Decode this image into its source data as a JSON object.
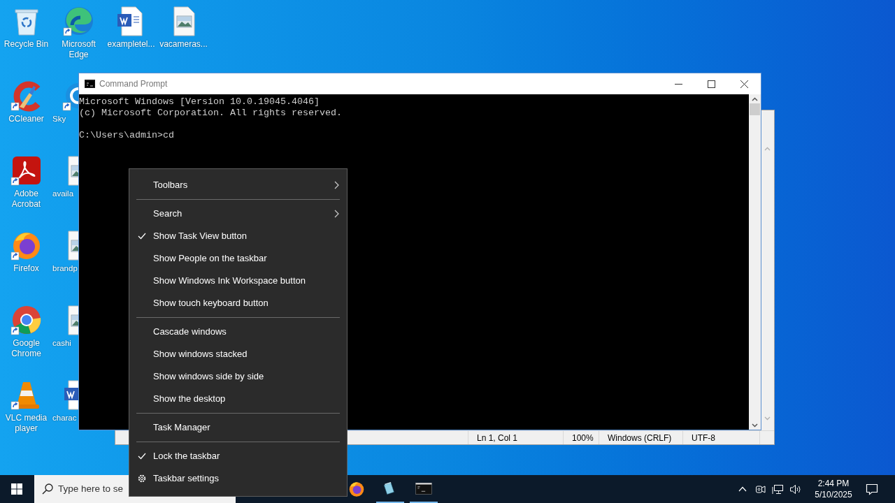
{
  "desktop": {
    "columns": [
      [
        {
          "label": "Recycle Bin",
          "kind": "recycle",
          "shortcut": false,
          "partly_hidden": false
        },
        {
          "label": "CCleaner",
          "kind": "ccleaner",
          "shortcut": true,
          "partly_hidden": false
        },
        {
          "label": "Adobe Acrobat",
          "kind": "acrobat",
          "shortcut": true,
          "partly_hidden": false
        },
        {
          "label": "Firefox",
          "kind": "firefox",
          "shortcut": true,
          "partly_hidden": false
        },
        {
          "label": "Google Chrome",
          "kind": "chrome",
          "shortcut": true,
          "partly_hidden": false
        },
        {
          "label": "VLC media player",
          "kind": "vlc",
          "shortcut": true,
          "partly_hidden": false
        }
      ],
      [
        {
          "label": "Microsoft Edge",
          "kind": "edge",
          "shortcut": true,
          "partly_hidden": false
        },
        {
          "label": "Sky",
          "kind": "skype",
          "shortcut": true,
          "partly_hidden": true
        },
        {
          "label": "availa",
          "kind": "image",
          "shortcut": false,
          "partly_hidden": true
        },
        {
          "label": "brandp",
          "kind": "image",
          "shortcut": false,
          "partly_hidden": true
        },
        {
          "label": "cashi",
          "kind": "image",
          "shortcut": false,
          "partly_hidden": true
        },
        {
          "label": "charac",
          "kind": "word",
          "shortcut": false,
          "partly_hidden": true
        }
      ],
      [
        {
          "label": "exampletel...",
          "kind": "word",
          "shortcut": false,
          "partly_hidden": false
        }
      ],
      [
        {
          "label": "vacameras...",
          "kind": "image",
          "shortcut": false,
          "partly_hidden": false
        }
      ]
    ]
  },
  "notepad": {
    "status_bar": [
      "Ln 1, Col 1",
      "100%",
      "Windows (CRLF)",
      "UTF-8"
    ]
  },
  "console": {
    "title": "Command Prompt",
    "banner": [
      "Microsoft Windows [Version 10.0.19045.4046]",
      "(c) Microsoft Corporation. All rights reserved."
    ],
    "prompt": "C:\\Users\\admin>cd"
  },
  "context_menu": {
    "groups": [
      [
        {
          "label": "Toolbars",
          "kind": "option",
          "checked": false,
          "submenu": true
        }
      ],
      [
        {
          "label": "Search",
          "kind": "option",
          "checked": false,
          "submenu": true
        },
        {
          "label": "Show Task View button",
          "kind": "option",
          "checked": true,
          "submenu": false
        },
        {
          "label": "Show People on the taskbar",
          "kind": "option",
          "checked": false,
          "submenu": false
        },
        {
          "label": "Show Windows Ink Workspace button",
          "kind": "option",
          "checked": false,
          "submenu": false
        },
        {
          "label": "Show touch keyboard button",
          "kind": "option",
          "checked": false,
          "submenu": false
        }
      ],
      [
        {
          "label": "Cascade windows",
          "kind": "option",
          "checked": false,
          "submenu": false
        },
        {
          "label": "Show windows stacked",
          "kind": "option",
          "checked": false,
          "submenu": false
        },
        {
          "label": "Show windows side by side",
          "kind": "option",
          "checked": false,
          "submenu": false
        },
        {
          "label": "Show the desktop",
          "kind": "option",
          "checked": false,
          "submenu": false
        }
      ],
      [
        {
          "label": "Task Manager",
          "kind": "option",
          "checked": false,
          "submenu": false
        }
      ],
      [
        {
          "label": "Lock the taskbar",
          "kind": "option",
          "checked": true,
          "submenu": false
        },
        {
          "label": "Taskbar settings",
          "kind": "settings",
          "checked": false,
          "submenu": false
        }
      ]
    ]
  },
  "taskbar": {
    "search": {
      "placeholder": "Type here to se"
    },
    "apps": [
      {
        "kind": "firefox",
        "running": false
      },
      {
        "kind": "notepad",
        "running": true
      },
      {
        "kind": "cmd",
        "running": true
      }
    ],
    "clock": {
      "time": "2:44 PM",
      "date": "5/10/2025"
    }
  }
}
